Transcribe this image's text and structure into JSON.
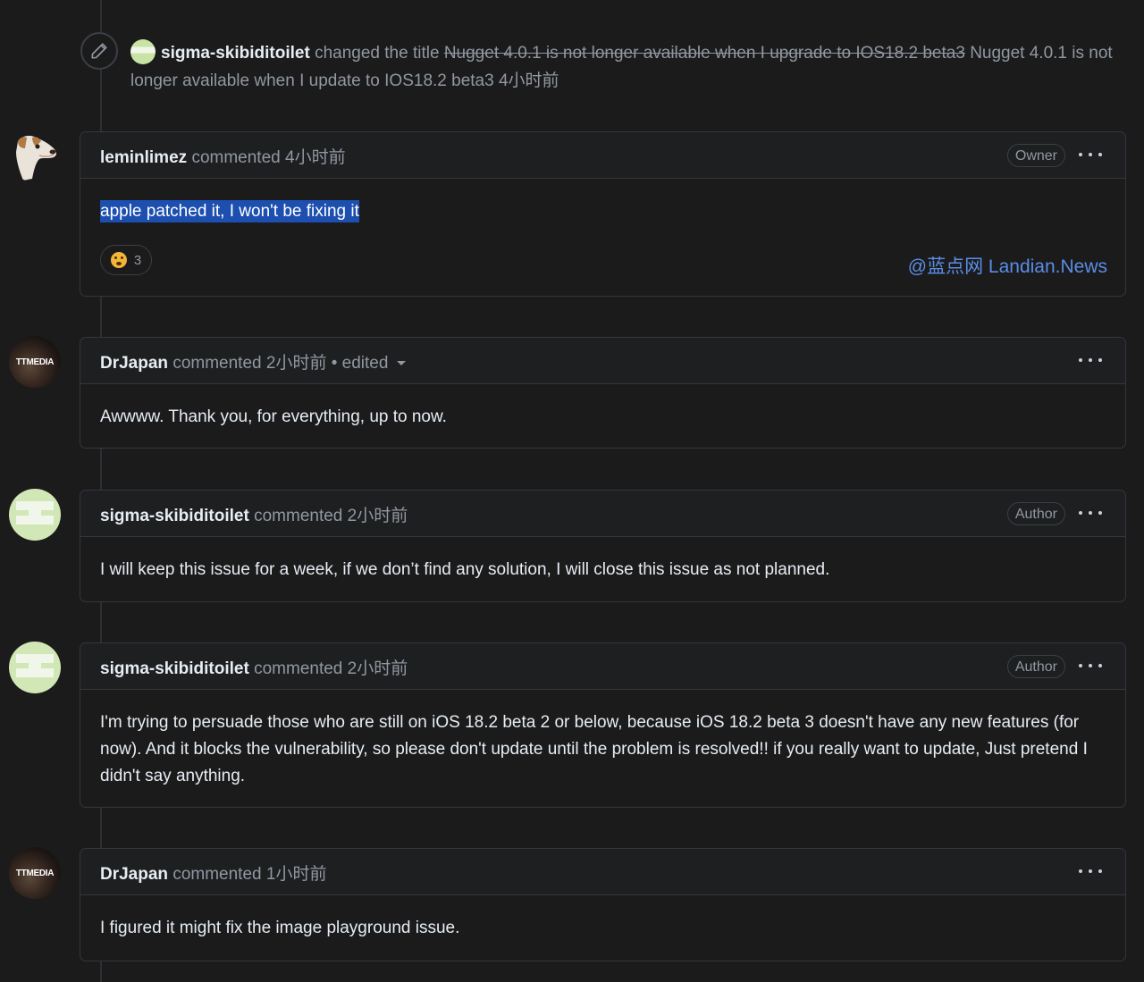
{
  "title_event": {
    "actor": "sigma-skibiditoilet",
    "action": "changed the title",
    "old_title": "Nugget 4.0.1 is not longer available when I upgrade to IOS18.2 beta3",
    "new_title": "Nugget 4.0.1 is not longer available when I update to IOS18.2 beta3",
    "time": "4小时前"
  },
  "comments": [
    {
      "author": "leminlimez",
      "action": "commented",
      "time": "4小时前",
      "badge": "Owner",
      "body": "apple patched it, I won't be fixing it",
      "reaction": {
        "emoji": "confused-face",
        "count": "3"
      },
      "watermark": "@蓝点网 Landian.News"
    },
    {
      "author": "DrJapan",
      "action": "commented",
      "time": "2小时前",
      "edited": "• edited",
      "avatar_label": "TTMEDIA",
      "body": "Awwww. Thank you, for everything, up to now."
    },
    {
      "author": "sigma-skibiditoilet",
      "action": "commented",
      "time": "2小时前",
      "badge": "Author",
      "body": "I will keep this issue for a week, if we don’t find any solution, I will close this issue as not planned."
    },
    {
      "author": "sigma-skibiditoilet",
      "action": "commented",
      "time": "2小时前",
      "badge": "Author",
      "body": "I'm trying to persuade those who are still on iOS 18.2 beta 2 or below, because iOS 18.2 beta 3 doesn't have any new features (for now). And it blocks the vulnerability, so please don't update until the problem is resolved!! if you really want to update, Just pretend I didn't say anything."
    },
    {
      "author": "DrJapan",
      "action": "commented",
      "time": "1小时前",
      "avatar_label": "TTMEDIA",
      "body": "I figured it might fix the image playground issue."
    }
  ]
}
